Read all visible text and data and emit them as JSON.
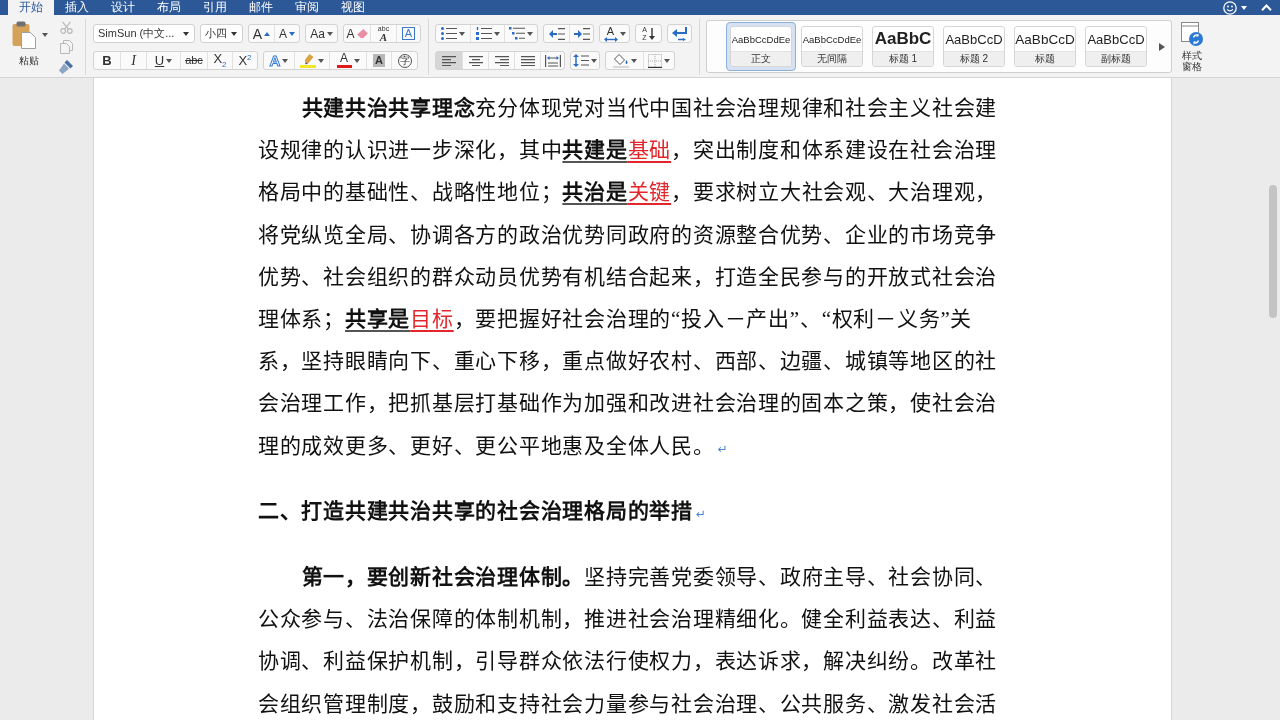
{
  "menu_tabs": [
    {
      "label": "开始",
      "selected": true
    },
    {
      "label": "插入",
      "selected": false
    },
    {
      "label": "设计",
      "selected": false
    },
    {
      "label": "布局",
      "selected": false
    },
    {
      "label": "引用",
      "selected": false
    },
    {
      "label": "邮件",
      "selected": false
    },
    {
      "label": "审阅",
      "selected": false
    },
    {
      "label": "视图",
      "selected": false
    }
  ],
  "ribbon": {
    "clipboard": {
      "paste_label": "粘贴",
      "tools": [
        {
          "kind": "cut",
          "disabled": true
        },
        {
          "kind": "copy",
          "disabled": true
        },
        {
          "kind": "painter",
          "disabled": false
        }
      ]
    },
    "font": {
      "name": "SimSun (中文...",
      "size": "小四",
      "rows": [
        [
          [
            {
              "kind": "grow",
              "glyph": "A"
            },
            {
              "kind": "shrink",
              "glyph": "A"
            }
          ],
          [
            {
              "kind": "case",
              "glyph": "Aa"
            }
          ],
          [
            {
              "kind": "clear",
              "glyph": "A"
            },
            {
              "kind": "phonetic",
              "glyph": "A",
              "ruby": "abc"
            },
            {
              "kind": "border",
              "glyph": "A"
            }
          ]
        ],
        [
          [
            {
              "kind": "bold",
              "glyph": "B"
            },
            {
              "kind": "italic",
              "glyph": "I"
            },
            {
              "kind": "underline",
              "glyph": "U"
            },
            {
              "kind": "strike",
              "glyph": "abc"
            },
            {
              "kind": "sub",
              "glyph": "X$_{2}$"
            },
            {
              "kind": "sup",
              "glyph": "X$^{2}$"
            }
          ],
          [
            {
              "kind": "effects",
              "glyph": "A"
            },
            {
              "kind": "highlight"
            },
            {
              "kind": "color",
              "glyph": "A"
            },
            {
              "kind": "shading",
              "glyph": "A"
            },
            {
              "kind": "enclose",
              "glyph": "字"
            }
          ]
        ]
      ]
    },
    "paragraph": {
      "rows": [
        [
          [
            {
              "kind": "bullets"
            },
            {
              "kind": "numbering"
            },
            {
              "kind": "multilevel"
            }
          ],
          [
            {
              "kind": "outdent"
            },
            {
              "kind": "indent"
            }
          ],
          [
            {
              "kind": "asian",
              "glyph": "A"
            }
          ],
          [
            {
              "kind": "sort",
              "glyph": "A",
              "glyph2": "Z"
            }
          ],
          [
            {
              "kind": "marks"
            }
          ]
        ],
        [
          [
            {
              "kind": "left",
              "selected": true
            },
            {
              "kind": "center",
              "selected": false
            },
            {
              "kind": "right",
              "selected": false
            },
            {
              "kind": "justify",
              "selected": false
            },
            {
              "kind": "distribute",
              "selected": false
            }
          ],
          [
            {
              "kind": "spacing"
            }
          ],
          [
            {
              "kind": "fill"
            },
            {
              "kind": "borders"
            }
          ]
        ]
      ]
    },
    "styles": {
      "items": [
        {
          "kind": "normal",
          "preview": "AaBbCcDdEe",
          "label": "正文",
          "selected": true
        },
        {
          "kind": "normal",
          "preview": "AaBbCcDdEe",
          "label": "无间隔",
          "selected": false
        },
        {
          "kind": "heading1",
          "preview": "AaBbC",
          "label": "标题 1",
          "selected": false
        },
        {
          "kind": "heading2",
          "preview": "AaBbCcD",
          "label": "标题 2",
          "selected": false
        },
        {
          "kind": "title",
          "preview": "AaBbCcD",
          "label": "标题",
          "selected": false
        },
        {
          "kind": "subtitle",
          "preview": "AaBbCcD",
          "label": "副标题",
          "selected": false
        }
      ],
      "pane_label": "样式窗格"
    }
  },
  "document": {
    "paragraphs": [
      {
        "kind": "body",
        "runs": [
          {
            "kind": "bold",
            "text": "共建共治共享理念"
          },
          {
            "kind": "plain",
            "text": "充分体现党对当代中国社会治理规律和社会主义社会建设规律的认识进一步深化，其中"
          },
          {
            "kind": "term",
            "text": "共建是"
          },
          {
            "kind": "key",
            "text": "基础"
          },
          {
            "kind": "plain",
            "text": "，突出制度和体系建设在社会治理格局中的基础性、战略性地位；"
          },
          {
            "kind": "term",
            "text": "共治是"
          },
          {
            "kind": "key",
            "text": "关键"
          },
          {
            "kind": "plain",
            "text": "，要求树立大社会观、大治理观，将党纵览全局、协调各方的政治优势同政府的资源整合优势、企业的市场竞争优势、社会组织的群众动员优势有机结合起来，打造全民参与的开放式社会治理体系；"
          },
          {
            "kind": "term",
            "text": "共享是"
          },
          {
            "kind": "key",
            "text": "目标"
          },
          {
            "kind": "plain",
            "text": "，要把握好社会治理的“投入－产出”、“权利－义务”关系，坚持眼睛向下、重心下移，重点做好农村、西部、边疆、城镇等地区的社会治理工作，把抓基层打基础作为加强和改进社会治理的固本之策，使社会治理的成效更多、更好、更公平地惠及全体人民。"
          },
          {
            "kind": "mark",
            "text": "↵"
          }
        ]
      },
      {
        "kind": "heading",
        "runs": [
          {
            "kind": "plain",
            "text": "二、打造共建共治共享的社会治理格局的举措"
          },
          {
            "kind": "mark",
            "text": "↵"
          }
        ]
      },
      {
        "kind": "body",
        "runs": [
          {
            "kind": "bold",
            "text": "第一，要创新社会治理体制。"
          },
          {
            "kind": "plain",
            "text": "坚持完善党委领导、政府主导、社会协同、公众参与、法治保障的体制机制，推进社会治理精细化。健全利益表达、利益协调、利益保护机制，引导群众依法行使权力，表达诉求，解决纠纷。改革社会组织管理制度，鼓励和支持社会力量参与社会治理、公共服务、激发社会活"
          }
        ]
      }
    ]
  }
}
